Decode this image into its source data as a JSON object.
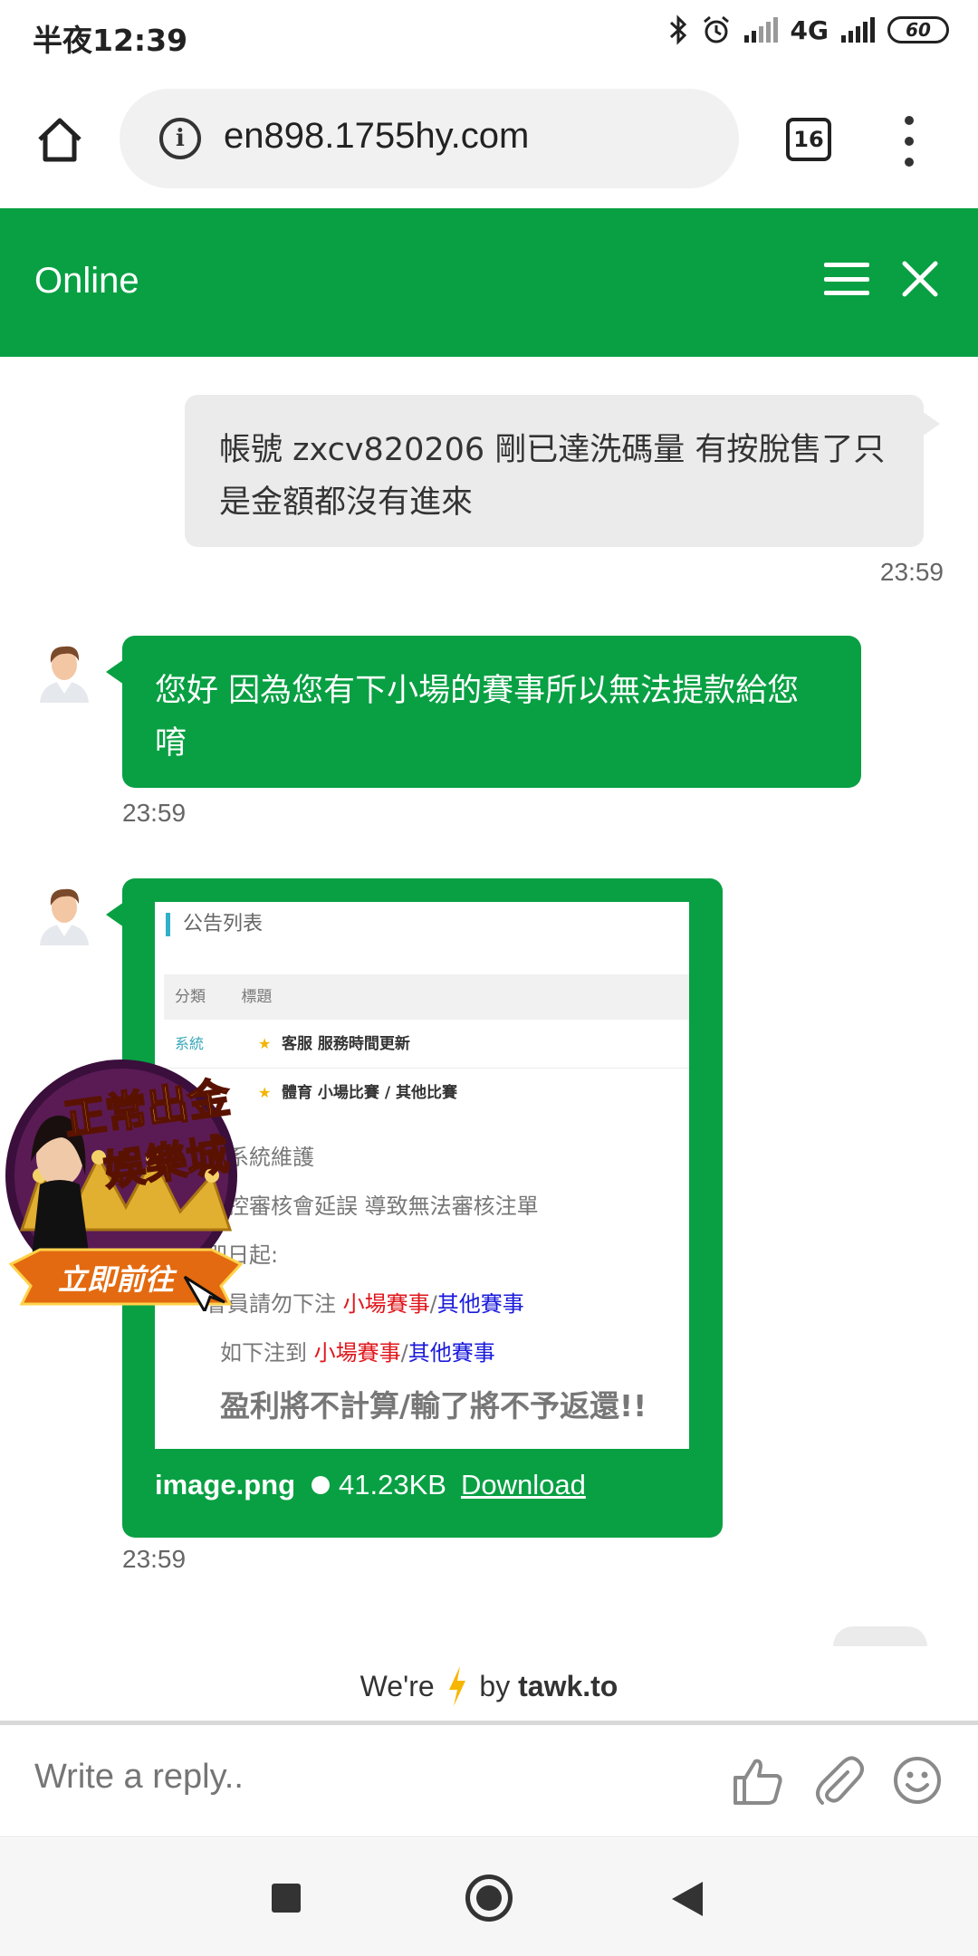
{
  "status_bar": {
    "time": "半夜12:39",
    "network": "4G",
    "battery": "60"
  },
  "browser": {
    "url": "en898.1755hy.com",
    "tab_count": "16"
  },
  "chat_header": {
    "title": "Online"
  },
  "messages": [
    {
      "direction": "outgoing",
      "text": "帳號 zxcv820206 剛已達洗碼量 有按脫售了只是金額都沒有進來",
      "time": "23:59"
    },
    {
      "direction": "incoming",
      "text": "您好 因為您有下小場的賽事所以無法提款給您唷",
      "time": "23:59"
    },
    {
      "direction": "incoming",
      "type": "file",
      "time": "23:59",
      "file": {
        "name": "image.png",
        "size": "41.23KB",
        "download_label": "Download"
      },
      "preview": {
        "title": "公告列表",
        "col_category": "分類",
        "col_title": "標題",
        "rows": [
          {
            "category": "系統",
            "title": "客服 服務時間更新"
          },
          {
            "category": "",
            "title": "體育 小場比賽 / 其他比賽"
          }
        ],
        "lines": [
          "因系統維護",
          "風控審核會延誤 導致無法審核注單",
          "即日起:",
          "會員請勿下注",
          "如下注到"
        ],
        "red_text": "小場賽事",
        "slash": "/",
        "blue_text": "其他賽事",
        "final": "盈利將不計算/輸了將不予返還!!"
      }
    }
  ],
  "ad": {
    "line1": "正常出金",
    "line2": "娛樂城",
    "cta": "立即前往"
  },
  "footer": {
    "powered_prefix": "We're",
    "powered_suffix": "by",
    "brand": "tawk.to"
  },
  "reply": {
    "placeholder": "Write a reply.."
  },
  "colors": {
    "brand_green": "#08a043",
    "bubble_grey": "#ebebeb"
  }
}
